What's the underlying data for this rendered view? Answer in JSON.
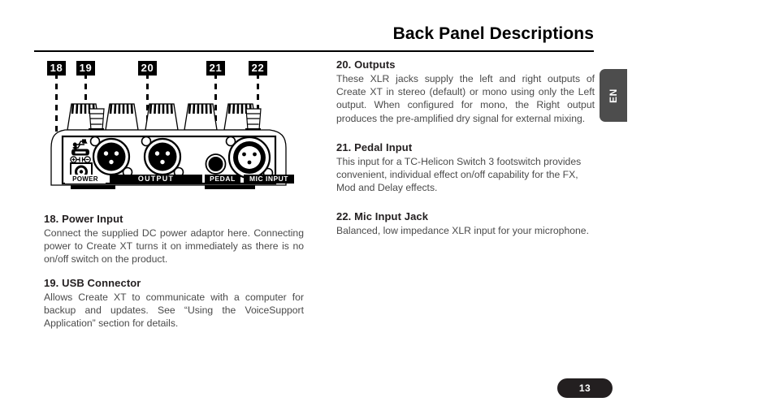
{
  "header": {
    "title": "Back Panel Descriptions"
  },
  "language_tab": {
    "label": "EN"
  },
  "footer": {
    "page_number": "13"
  },
  "figure": {
    "name": "back-panel-diagram",
    "callouts": [
      {
        "id": "18",
        "label": "18"
      },
      {
        "id": "19",
        "label": "19"
      },
      {
        "id": "20",
        "label": "20"
      },
      {
        "id": "21",
        "label": "21"
      },
      {
        "id": "22",
        "label": "22"
      }
    ],
    "port_labels": [
      {
        "id": "power",
        "text": "POWER"
      },
      {
        "id": "output",
        "text": "OUTPUT"
      },
      {
        "id": "pedal",
        "text": "PEDAL"
      },
      {
        "id": "mic-input",
        "text": "MIC INPUT"
      }
    ]
  },
  "left_column": {
    "sections": [
      {
        "heading": "18. Power Input",
        "body": "Connect the supplied DC power adaptor here. Connecting power to Create XT turns it on immediately as there is no on/off switch on the product."
      },
      {
        "heading": "19. USB Connector",
        "body": "Allows Create XT to communicate with a computer for backup and updates. See “Using the VoiceSupport Application” section for details."
      }
    ]
  },
  "right_column": {
    "sections": [
      {
        "heading": "20. Outputs",
        "body": "These XLR jacks supply the left and right outputs of Create XT in stereo (default) or mono using only the Left output. When configured for mono, the Right output produces the pre-amplified dry signal for external mixing."
      },
      {
        "heading": "21. Pedal Input",
        "body": "This input for a TC-Helicon Switch 3 footswitch provides convenient, individual effect on/off capability for the FX,  Mod and Delay effects."
      },
      {
        "heading": "22. Mic Input Jack",
        "body": "Balanced, low impedance XLR input for your microphone."
      }
    ]
  },
  "colors": {
    "ink": "#231f20",
    "body_text": "#4a4a4a",
    "tab_gray": "#4d4d4d",
    "black": "#000000"
  }
}
